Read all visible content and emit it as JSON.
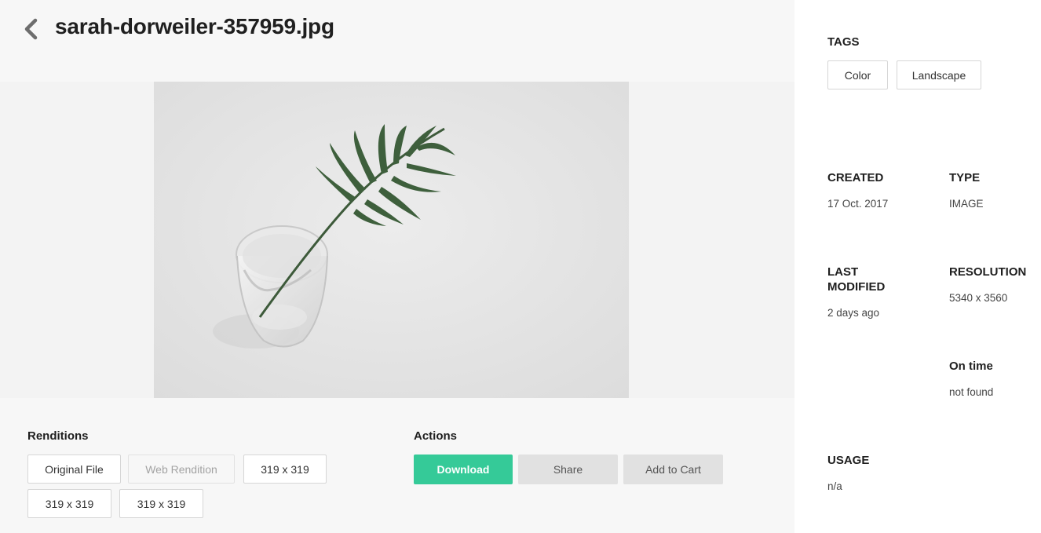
{
  "header": {
    "title": "sarah-dorweiler-357959.jpg",
    "back_icon": "chevron-left-icon"
  },
  "preview": {
    "image_subject": "palm-leaf-in-glass-photo"
  },
  "renditions": {
    "label": "Renditions",
    "items": [
      {
        "label": "Original File",
        "disabled": false
      },
      {
        "label": "Web Rendition",
        "disabled": true
      },
      {
        "label": "319 x 319",
        "disabled": false
      },
      {
        "label": "319 x 319",
        "disabled": false
      },
      {
        "label": "319 x 319",
        "disabled": false
      }
    ]
  },
  "actions": {
    "label": "Actions",
    "download": "Download",
    "share": "Share",
    "add_to_cart": "Add to Cart",
    "accent_color": "#35ca98"
  },
  "sidebar": {
    "tags_label": "TAGS",
    "tags": [
      "Color",
      "Landscape"
    ],
    "created_label": "CREATED",
    "created_value": "17 Oct. 2017",
    "type_label": "TYPE",
    "type_value": "IMAGE",
    "last_modified_label_line1": "LAST",
    "last_modified_label_line2": "MODIFIED",
    "last_modified_value": "2 days ago",
    "resolution_label": "RESOLUTION",
    "resolution_value": "5340 x 3560",
    "on_time_label": "On time",
    "on_time_value": "not found",
    "usage_label": "USAGE",
    "usage_value": "n/a"
  }
}
